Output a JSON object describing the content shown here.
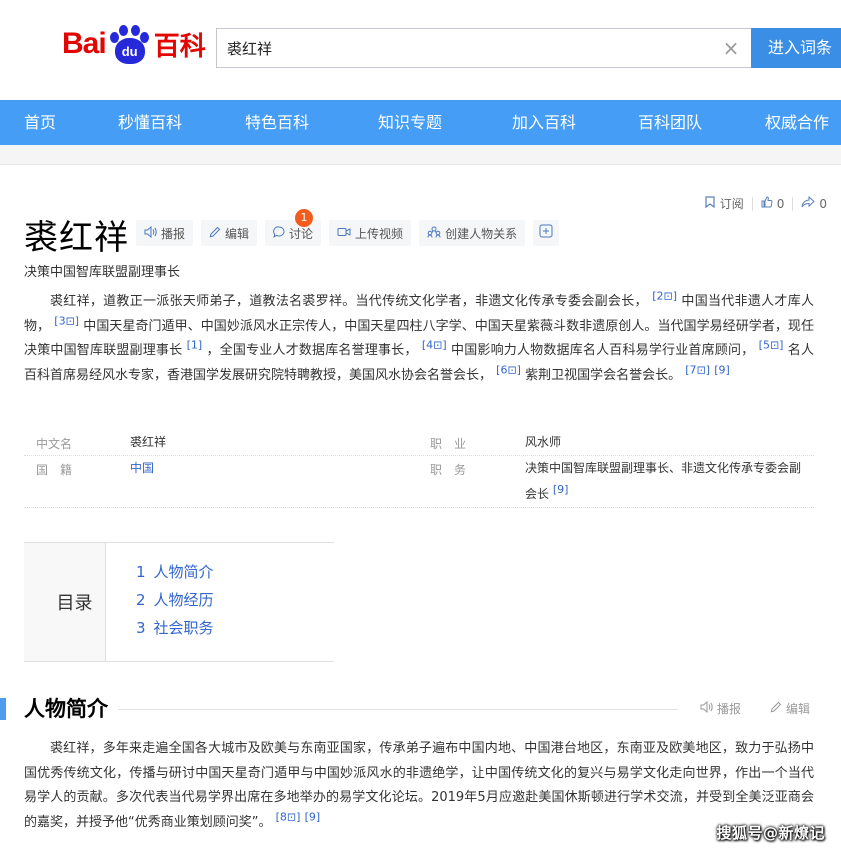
{
  "header": {
    "logo_bai": "Bai",
    "logo_du": "du",
    "logo_baike": "百科",
    "search_value": "裘红祥",
    "clear_icon": "close-icon",
    "search_button": "进入词条"
  },
  "nav": {
    "items": [
      "首页",
      "秒懂百科",
      "特色百科",
      "知识专题",
      "加入百科",
      "百科团队",
      "权威合作"
    ]
  },
  "top_actions": {
    "subscribe": "订阅",
    "like_count": "0",
    "share_count": "0"
  },
  "entry": {
    "title": "裘红祥",
    "tools": {
      "broadcast": "播报",
      "edit": "编辑",
      "discuss": "讨论",
      "discuss_badge": "1",
      "upload_video": "上传视频",
      "create_relation": "创建人物关系"
    },
    "subtitle": "决策中国智库联盟副理事长",
    "summary": {
      "s1": "裘红祥，道教正一派张天师弟子，道教法名裘罗祥。当代传统文化学者，非遗文化传承专委会副会长，",
      "r2": "[2",
      "s2": "中国当代非遗人才库人物，",
      "r3": "[3",
      "s3": "中国天星奇门遁甲、中国妙派风水正宗传人，中国天星四柱八字学、中国天星紫薇斗数非遗原创人。当代国学易经研学者，现任决策中国智库联盟副理事长",
      "r1": "[1]",
      "s4": "，全国专业人才数据库名誉理事长，",
      "r4": "[4",
      "s5": "中国影响力人物数据库名人百科易学行业首席顾问，",
      "r5": "[5",
      "s6": "名人百科首席易经风水专家，香港国学发展研究院特聘教授，美国风水协会名誉会长，",
      "r6": "[6",
      "s7": "紫荆卫视国学会名誉会长。",
      "r7": "[7",
      "r9": "[9]"
    },
    "basic_info": {
      "k_name": "中文名",
      "v_name": "裘红祥",
      "k_job": "职　业",
      "v_job": "风水师",
      "k_nation": "国　籍",
      "v_nation": "中国",
      "k_post": "职　务",
      "v_post": "决策中国智库联盟副理事长、非遗文化传承专委会副会长",
      "v_post_ref": "[9]"
    },
    "catalog": {
      "title": "目录",
      "items": [
        {
          "num": "1",
          "label": "人物简介"
        },
        {
          "num": "2",
          "label": "人物经历"
        },
        {
          "num": "3",
          "label": "社会职务"
        }
      ]
    },
    "section1": {
      "title": "人物简介",
      "broadcast": "播报",
      "edit": "编辑",
      "text": "裘红祥，多年来走遍全国各大城市及欧美与东南亚国家，传承弟子遍布中国内地、中国港台地区，东南亚及欧美地区，致力于弘扬中国优秀传统文化，传播与研讨中国天星奇门遁甲与中国妙派风水的非遗绝学，让中国传统文化的复兴与易学文化走向世界，作出一个当代易学人的贡献。多次代表当代易学界出席在多地举办的易学文化论坛。2019年5月应邀赴美国休斯顿进行学术交流，并受到全美泛亚商会的嘉奖，并授予他“优秀商业策划顾问奖”。",
      "r8": "[8",
      "r9": "[9]"
    }
  },
  "watermark": "搜狐号@新燎记",
  "colors": {
    "nav_bg": "#459df5",
    "link": "#3366cc",
    "logo_red": "#e10601",
    "logo_blue": "#2529d8",
    "badge": "#f25d1e"
  }
}
